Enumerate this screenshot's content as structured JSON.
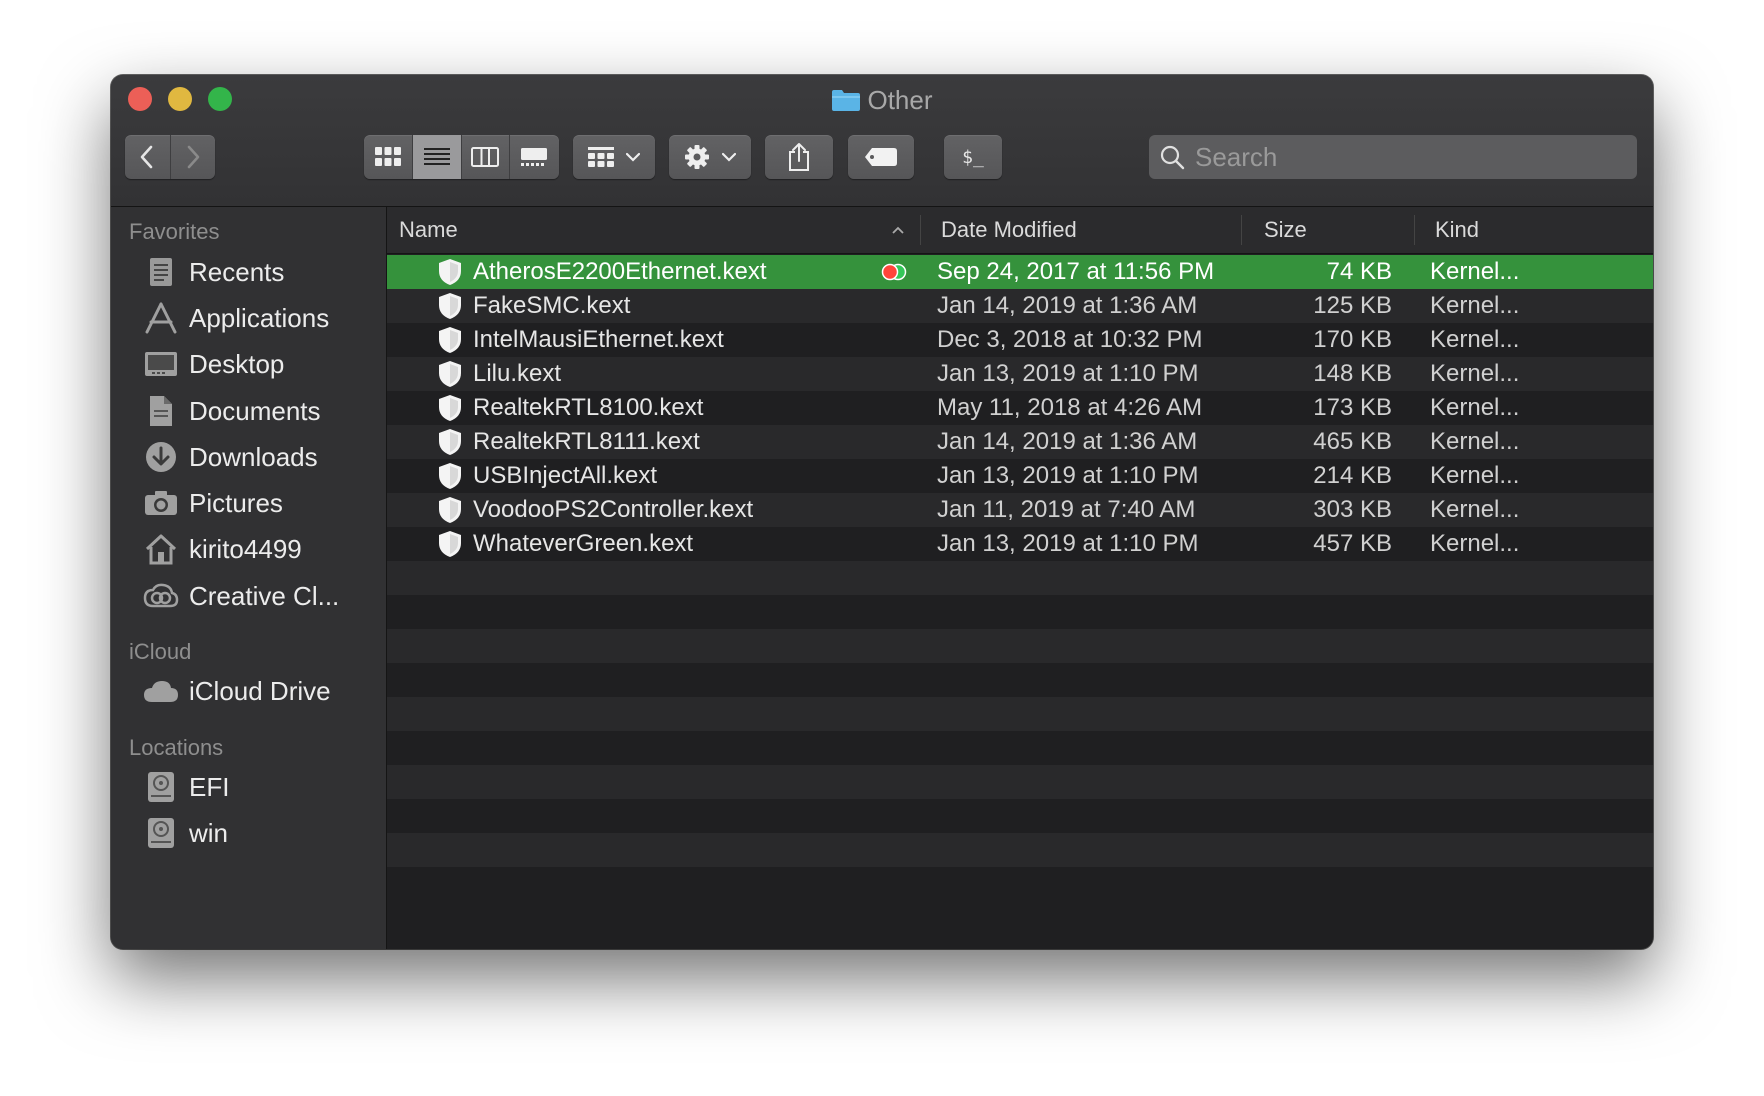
{
  "window": {
    "title": "Other"
  },
  "toolbar": {
    "back_icon": "chevron-left-icon",
    "forward_icon": "chevron-right-icon",
    "view_modes": [
      "icon-view",
      "list-view",
      "column-view",
      "gallery-view"
    ],
    "active_view": "list-view",
    "terminal_label": "$_",
    "search_placeholder": "Search"
  },
  "sidebar": {
    "sections": [
      {
        "title": "Favorites",
        "items": [
          {
            "label": "Recents",
            "icon": "clock-icon"
          },
          {
            "label": "Applications",
            "icon": "applications-icon"
          },
          {
            "label": "Desktop",
            "icon": "desktop-icon"
          },
          {
            "label": "Documents",
            "icon": "document-icon"
          },
          {
            "label": "Downloads",
            "icon": "download-icon"
          },
          {
            "label": "Pictures",
            "icon": "camera-icon"
          },
          {
            "label": "kirito4499",
            "icon": "home-icon"
          },
          {
            "label": "Creative Cl...",
            "icon": "creative-cloud-icon"
          }
        ]
      },
      {
        "title": "iCloud",
        "items": [
          {
            "label": "iCloud Drive",
            "icon": "cloud-icon"
          }
        ]
      },
      {
        "title": "Locations",
        "items": [
          {
            "label": "EFI",
            "icon": "disk-icon"
          },
          {
            "label": "win",
            "icon": "disk-icon"
          }
        ]
      }
    ]
  },
  "columns": {
    "name": "Name",
    "date": "Date Modified",
    "size": "Size",
    "kind": "Kind"
  },
  "files": [
    {
      "name": "AtherosE2200Ethernet.kext",
      "date": "Sep 24, 2017 at 11:56 PM",
      "size": "74 KB",
      "kind": "Kernel...",
      "selected": true
    },
    {
      "name": "FakeSMC.kext",
      "date": "Jan 14, 2019 at 1:36 AM",
      "size": "125 KB",
      "kind": "Kernel..."
    },
    {
      "name": "IntelMausiEthernet.kext",
      "date": "Dec 3, 2018 at 10:32 PM",
      "size": "170 KB",
      "kind": "Kernel..."
    },
    {
      "name": "Lilu.kext",
      "date": "Jan 13, 2019 at 1:10 PM",
      "size": "148 KB",
      "kind": "Kernel..."
    },
    {
      "name": "RealtekRTL8100.kext",
      "date": "May 11, 2018 at 4:26 AM",
      "size": "173 KB",
      "kind": "Kernel..."
    },
    {
      "name": "RealtekRTL8111.kext",
      "date": "Jan 14, 2019 at 1:36 AM",
      "size": "465 KB",
      "kind": "Kernel..."
    },
    {
      "name": "USBInjectAll.kext",
      "date": "Jan 13, 2019 at 1:10 PM",
      "size": "214 KB",
      "kind": "Kernel..."
    },
    {
      "name": "VoodooPS2Controller.kext",
      "date": "Jan 11, 2019 at 7:40 AM",
      "size": "303 KB",
      "kind": "Kernel..."
    },
    {
      "name": "WhateverGreen.kext",
      "date": "Jan 13, 2019 at 1:10 PM",
      "size": "457 KB",
      "kind": "Kernel..."
    }
  ],
  "colors": {
    "selection": "#35923c",
    "window_bg": "#1f1f21",
    "accent_folder": "#5ab4e6"
  }
}
